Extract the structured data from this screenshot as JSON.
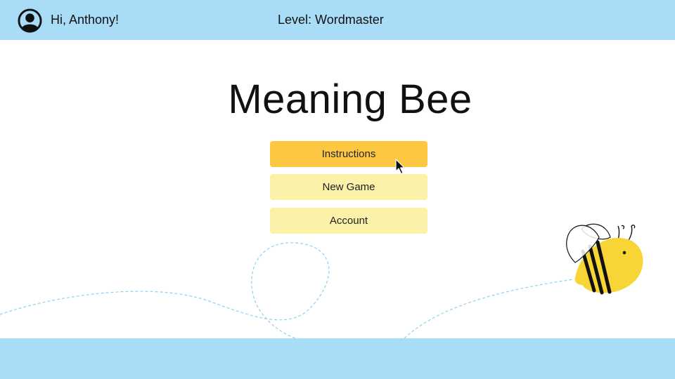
{
  "header": {
    "greeting": "Hi, Anthony!",
    "level": "Level: Wordmaster",
    "avatar_icon": "user-avatar-icon"
  },
  "main": {
    "title": "Meaning Bee",
    "buttons": [
      {
        "label": "Instructions",
        "state": "hover"
      },
      {
        "label": "New Game"
      },
      {
        "label": "Account"
      }
    ]
  },
  "colors": {
    "header_bg": "#a8dcf7",
    "primary_button": "#fdc741",
    "secondary_button": "#fbf1a8",
    "bee_body": "#f7d535",
    "flight_path": "#8fd0ef"
  },
  "decorations": {
    "mascot_icon": "bee-icon",
    "cursor_icon": "pointer-cursor-icon"
  }
}
